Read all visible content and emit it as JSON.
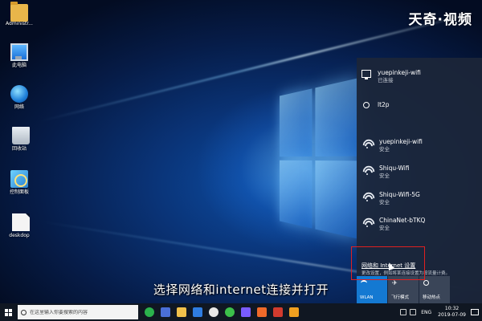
{
  "watermark": "天奇·视频",
  "desktop_icons": [
    {
      "label": "Administr...",
      "icon": "folder-icon"
    },
    {
      "label": "此电脑",
      "icon": "computer-icon"
    },
    {
      "label": "网络",
      "icon": "network-globe-icon"
    },
    {
      "label": "回收站",
      "icon": "recycle-bin-icon"
    },
    {
      "label": "控制面板",
      "icon": "control-panel-icon"
    },
    {
      "label": "deskdop",
      "icon": "file-icon"
    }
  ],
  "network_flyout": {
    "networks": [
      {
        "name": "yuepinkeji-wifi",
        "status": "已连接",
        "icon": "ethernet-monitor-icon"
      },
      {
        "name": "lt2p",
        "status": "",
        "icon": "vpn-icon"
      },
      {
        "name": "yuepinkeji-wifi",
        "status": "安全",
        "icon": "wifi-icon"
      },
      {
        "name": "Shiqu-Wifi",
        "status": "安全",
        "icon": "wifi-icon"
      },
      {
        "name": "Shiqu-Wifi-5G",
        "status": "安全",
        "icon": "wifi-icon"
      },
      {
        "name": "ChinaNet-bTKQ",
        "status": "安全",
        "icon": "wifi-icon"
      }
    ],
    "settings_link": "网络和 Internet 设置",
    "settings_desc": "更改设置，例如将某连接设置为按流量计费。",
    "quick_actions": [
      {
        "label": "WLAN",
        "active": true,
        "icon": "wifi-icon"
      },
      {
        "label": "飞行模式",
        "active": false,
        "icon": "airplane-icon"
      },
      {
        "label": "移动热点",
        "active": false,
        "icon": "hotspot-icon"
      }
    ]
  },
  "subtitle": "选择网络和internet连接并打开",
  "taskbar": {
    "search_placeholder": "在这里输入你要搜索的内容",
    "language": "ENG",
    "time": "10:32",
    "date": "2019-07-09"
  },
  "colors": {
    "accent": "#1479d2",
    "highlight_box": "#e02020",
    "taskbar": "#101722"
  }
}
